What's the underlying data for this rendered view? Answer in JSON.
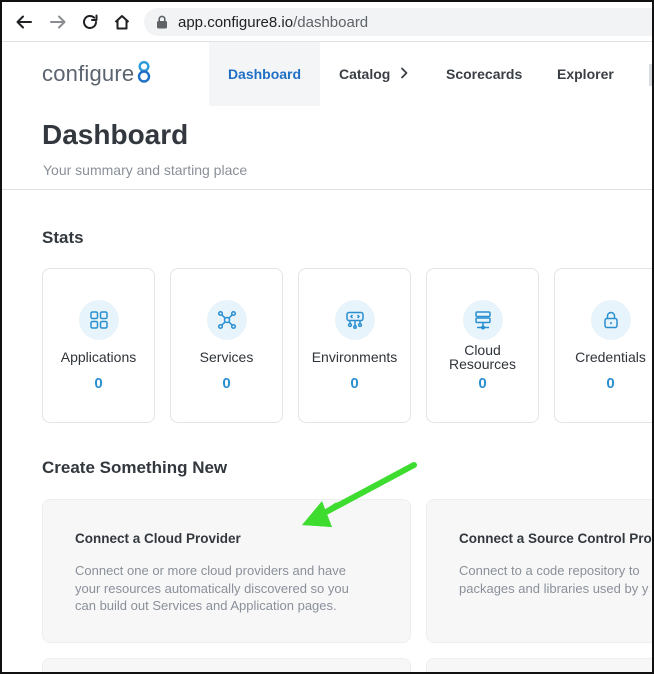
{
  "browser": {
    "url_host": "app.configure8.io",
    "url_path": "/dashboard",
    "icons": [
      "back-arrow-icon",
      "forward-arrow-icon",
      "reload-icon",
      "home-icon",
      "lock-icon"
    ]
  },
  "app": {
    "logo_text": "configure",
    "logo_mark": "8"
  },
  "nav": {
    "dashboard": "Dashboard",
    "catalog": "Catalog",
    "catalog_chevron": "›",
    "scorecards": "Scorecards",
    "explorer": "Explorer"
  },
  "page": {
    "title": "Dashboard",
    "subtitle": "Your summary and starting place"
  },
  "stats": {
    "title": "Stats",
    "items": [
      {
        "label": "Applications",
        "value": "0",
        "icon": "applications-icon"
      },
      {
        "label": "Services",
        "value": "0",
        "icon": "services-icon"
      },
      {
        "label": "Environments",
        "value": "0",
        "icon": "environments-icon"
      },
      {
        "label": "Cloud Resources",
        "label_line1": "Cloud",
        "label_line2": "Resources",
        "value": "0",
        "icon": "cloud-resources-icon"
      },
      {
        "label": "Credentials",
        "value": "0",
        "icon": "credentials-icon"
      }
    ]
  },
  "create": {
    "title": "Create Something New",
    "cards": [
      {
        "title": "Connect a Cloud Provider",
        "desc_lines": [
          "Connect one or more cloud providers and have",
          "your resources automatically discovered so you",
          "can build out Services and Application pages."
        ]
      },
      {
        "title": "Connect a Source Control Provi",
        "desc_lines": [
          "Connect to a code repository to",
          "packages and libraries used by y"
        ]
      }
    ]
  },
  "colors": {
    "accent": "#1f6fc5",
    "stat_value": "#2a8fd0",
    "annotation_arrow": "#3ddc2f"
  }
}
